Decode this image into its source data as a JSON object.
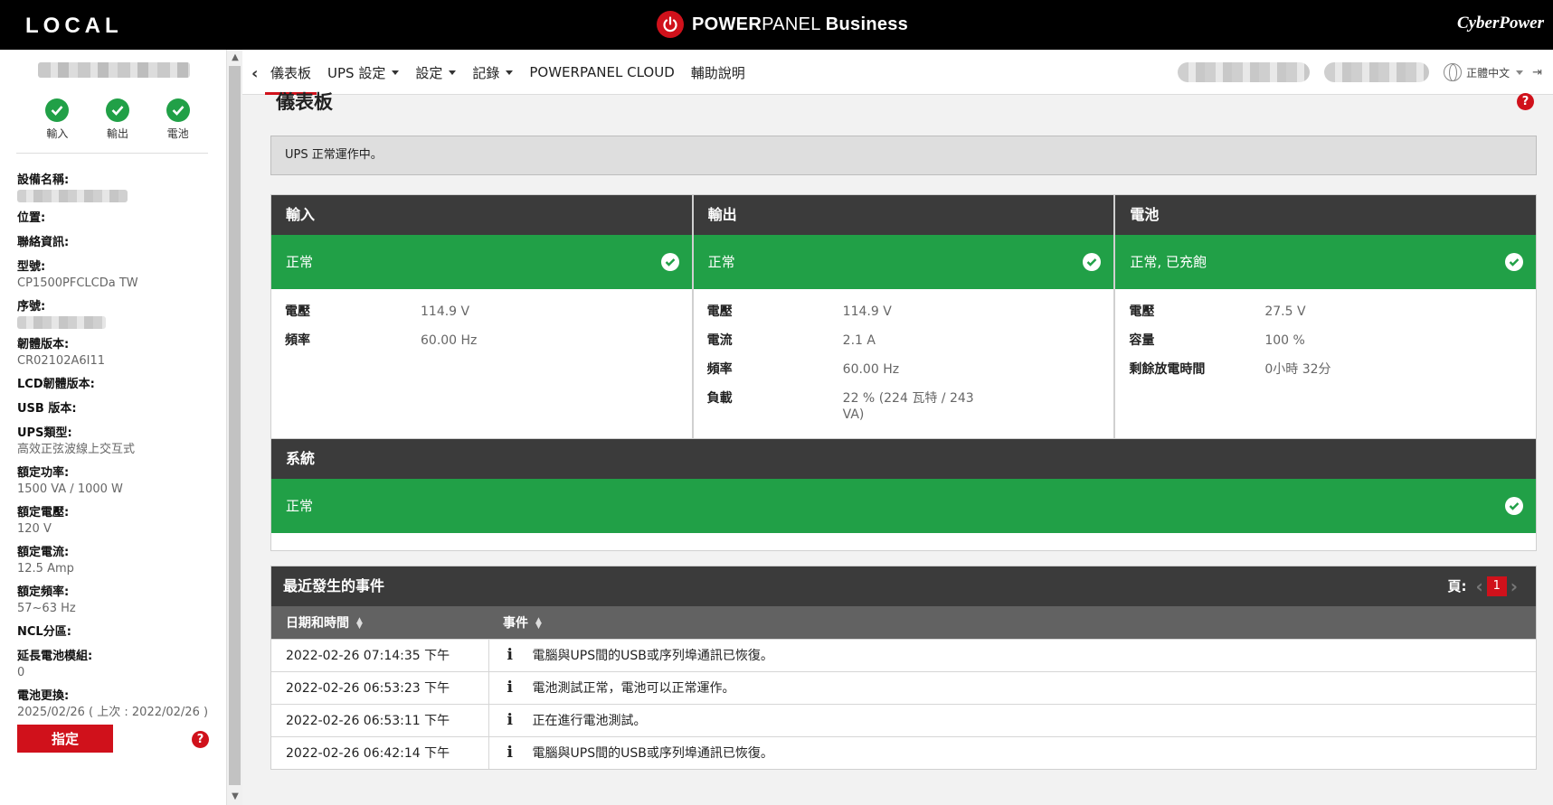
{
  "header": {
    "brand_left": "LOCAL",
    "product_name_bold": "POWER",
    "product_name_thin": "PANEL",
    "product_edition": "Business",
    "brand_right": "CyberPower",
    "accent_color": "#d0111b"
  },
  "nav": {
    "back_icon": "chevron-left-icon",
    "items": [
      {
        "label": "儀表板",
        "dropdown": false,
        "active": true
      },
      {
        "label": "UPS 設定",
        "dropdown": true,
        "active": false
      },
      {
        "label": "設定",
        "dropdown": true,
        "active": false
      },
      {
        "label": "記錄",
        "dropdown": true,
        "active": false
      },
      {
        "label": "POWERPANEL CLOUD",
        "dropdown": false,
        "active": false
      },
      {
        "label": "輔助說明",
        "dropdown": false,
        "active": false
      }
    ],
    "language": "正體中文"
  },
  "sidebar": {
    "status": [
      {
        "label": "輸入"
      },
      {
        "label": "輸出"
      },
      {
        "label": "電池"
      }
    ],
    "info": [
      {
        "label": "設備名稱:",
        "value": ""
      },
      {
        "label": "位置:",
        "value": ""
      },
      {
        "label": "聯絡資訊:",
        "value": ""
      },
      {
        "label": "型號:",
        "value": "CP1500PFCLCDa TW"
      },
      {
        "label": "序號:",
        "value": ""
      },
      {
        "label": "韌體版本:",
        "value": "CR02102A6I11"
      },
      {
        "label": "LCD韌體版本:",
        "value": ""
      },
      {
        "label": "USB 版本:",
        "value": ""
      },
      {
        "label": "UPS類型:",
        "value": "高效正弦波線上交互式"
      },
      {
        "label": "額定功率:",
        "value": "1500 VA / 1000 W"
      },
      {
        "label": "額定電壓:",
        "value": "120 V"
      },
      {
        "label": "額定電流:",
        "value": "12.5 Amp"
      },
      {
        "label": "額定頻率:",
        "value": "57~63 Hz"
      },
      {
        "label": "NCL分區:",
        "value": ""
      },
      {
        "label": "延長電池模組:",
        "value": "0"
      },
      {
        "label": "電池更換:",
        "value": "2025/02/26 ( 上次 : 2022/02/26 )"
      }
    ],
    "assign_button": "指定"
  },
  "dashboard": {
    "title": "儀表板",
    "alert": "UPS 正常運作中。",
    "status_color": "#21a047",
    "panels": [
      {
        "title": "輸入",
        "status": "正常",
        "metrics": [
          {
            "label": "電壓",
            "value": "114.9 V"
          },
          {
            "label": "頻率",
            "value": "60.00 Hz"
          }
        ]
      },
      {
        "title": "輸出",
        "status": "正常",
        "metrics": [
          {
            "label": "電壓",
            "value": "114.9 V"
          },
          {
            "label": "電流",
            "value": "2.1 A"
          },
          {
            "label": "頻率",
            "value": "60.00 Hz"
          },
          {
            "label": "負載",
            "value": "22 % (224 瓦特 / 243 VA)"
          }
        ]
      },
      {
        "title": "電池",
        "status": "正常, 已充飽",
        "metrics": [
          {
            "label": "電壓",
            "value": "27.5 V"
          },
          {
            "label": "容量",
            "value": "100 %"
          },
          {
            "label": "剩餘放電時間",
            "value": "0小時 32分"
          }
        ]
      }
    ],
    "system": {
      "title": "系統",
      "status": "正常"
    }
  },
  "events": {
    "title": "最近發生的事件",
    "page_label": "頁:",
    "current_page": "1",
    "columns": [
      "日期和時間",
      "事件"
    ],
    "rows": [
      {
        "datetime": "2022-02-26 07:14:35 下午",
        "event": "電腦與UPS間的USB或序列埠通訊已恢復。"
      },
      {
        "datetime": "2022-02-26 06:53:23 下午",
        "event": "電池測試正常，電池可以正常運作。"
      },
      {
        "datetime": "2022-02-26 06:53:11 下午",
        "event": "正在進行電池測試。"
      },
      {
        "datetime": "2022-02-26 06:42:14 下午",
        "event": "電腦與UPS間的USB或序列埠通訊已恢復。"
      }
    ]
  }
}
